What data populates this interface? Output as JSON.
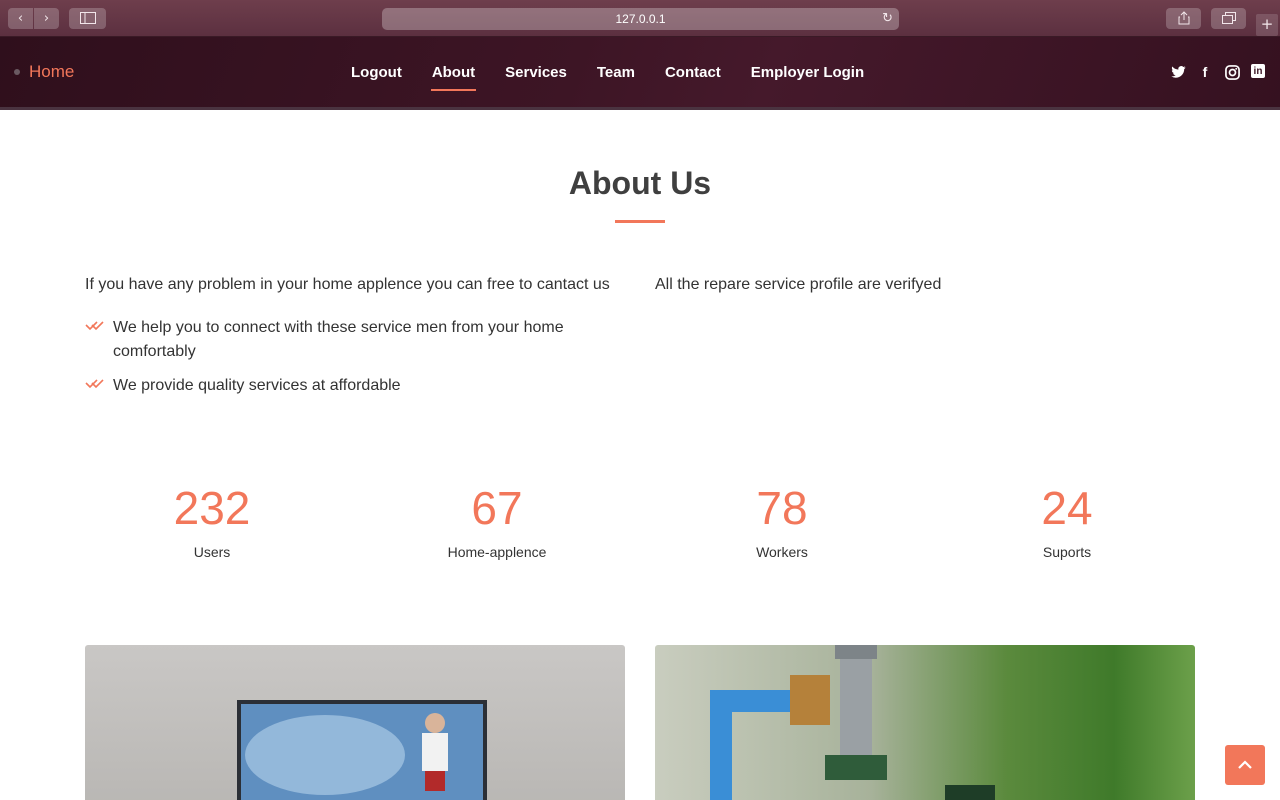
{
  "browser": {
    "url": "127.0.0.1",
    "back_glyph": "‹",
    "forward_glyph": "›",
    "reload_glyph": "↻",
    "new_tab_glyph": "+"
  },
  "header": {
    "logo": "Home",
    "nav": [
      {
        "label": "Logout",
        "active": false
      },
      {
        "label": "About",
        "active": true
      },
      {
        "label": "Services",
        "active": false
      },
      {
        "label": "Team",
        "active": false
      },
      {
        "label": "Contact",
        "active": false
      },
      {
        "label": "Employer Login",
        "active": false
      }
    ],
    "social_icons": [
      "twitter-icon",
      "facebook-icon",
      "instagram-icon",
      "linkedin-icon"
    ],
    "social_glyphs": {
      "facebook": "f",
      "linkedin": "in"
    }
  },
  "about": {
    "title": "About Us",
    "intro_left": "If you have any problem in your home applence you can free to cantact us",
    "intro_right": "All the repare service profile are verifyed",
    "points": [
      "We help you to connect with these service men from your home comfortably",
      "We provide quality services at affordable"
    ]
  },
  "counters": [
    {
      "value": "232",
      "label": "Users"
    },
    {
      "value": "67",
      "label": "Home-applence"
    },
    {
      "value": "78",
      "label": "Workers"
    },
    {
      "value": "24",
      "label": "Suports"
    }
  ],
  "colors": {
    "accent": "#f2775a",
    "header_bg": "#3d1525",
    "text": "#333333"
  }
}
